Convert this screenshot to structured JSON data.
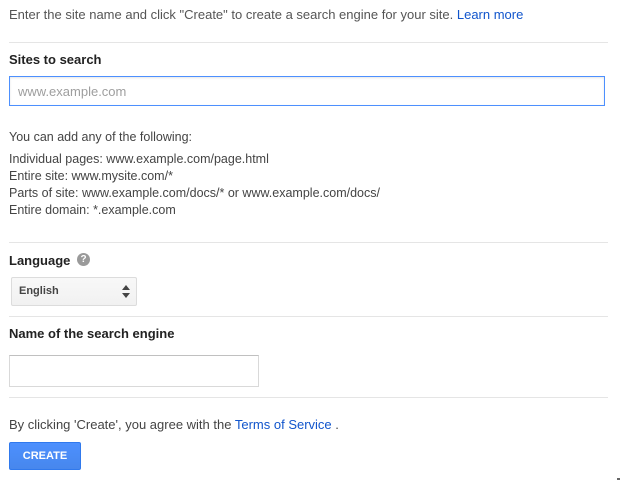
{
  "intro": {
    "text": "Enter the site name and click \"Create\" to create a search engine for your site.",
    "learn_more": "Learn more"
  },
  "sites_section": {
    "heading": "Sites to search",
    "placeholder": "www.example.com",
    "hints": [
      "You can add any of the following:",
      "Individual pages: www.example.com/page.html",
      "Entire site: www.mysite.com/*",
      "Parts of site: www.example.com/docs/* or www.example.com/docs/",
      "Entire domain: *.example.com"
    ]
  },
  "language_section": {
    "heading": "Language",
    "help_icon": "question-icon",
    "help_glyph": "?",
    "selected": "English"
  },
  "name_section": {
    "heading": "Name of the search engine",
    "value": ""
  },
  "terms": {
    "prefix": "By clicking 'Create', you agree with the",
    "link": "Terms of Service",
    "suffix": "."
  },
  "create_button": {
    "label": "CREATE"
  },
  "colors": {
    "accent": "#4d90fe",
    "link": "#1155cc",
    "divider": "#e5e5e5"
  }
}
